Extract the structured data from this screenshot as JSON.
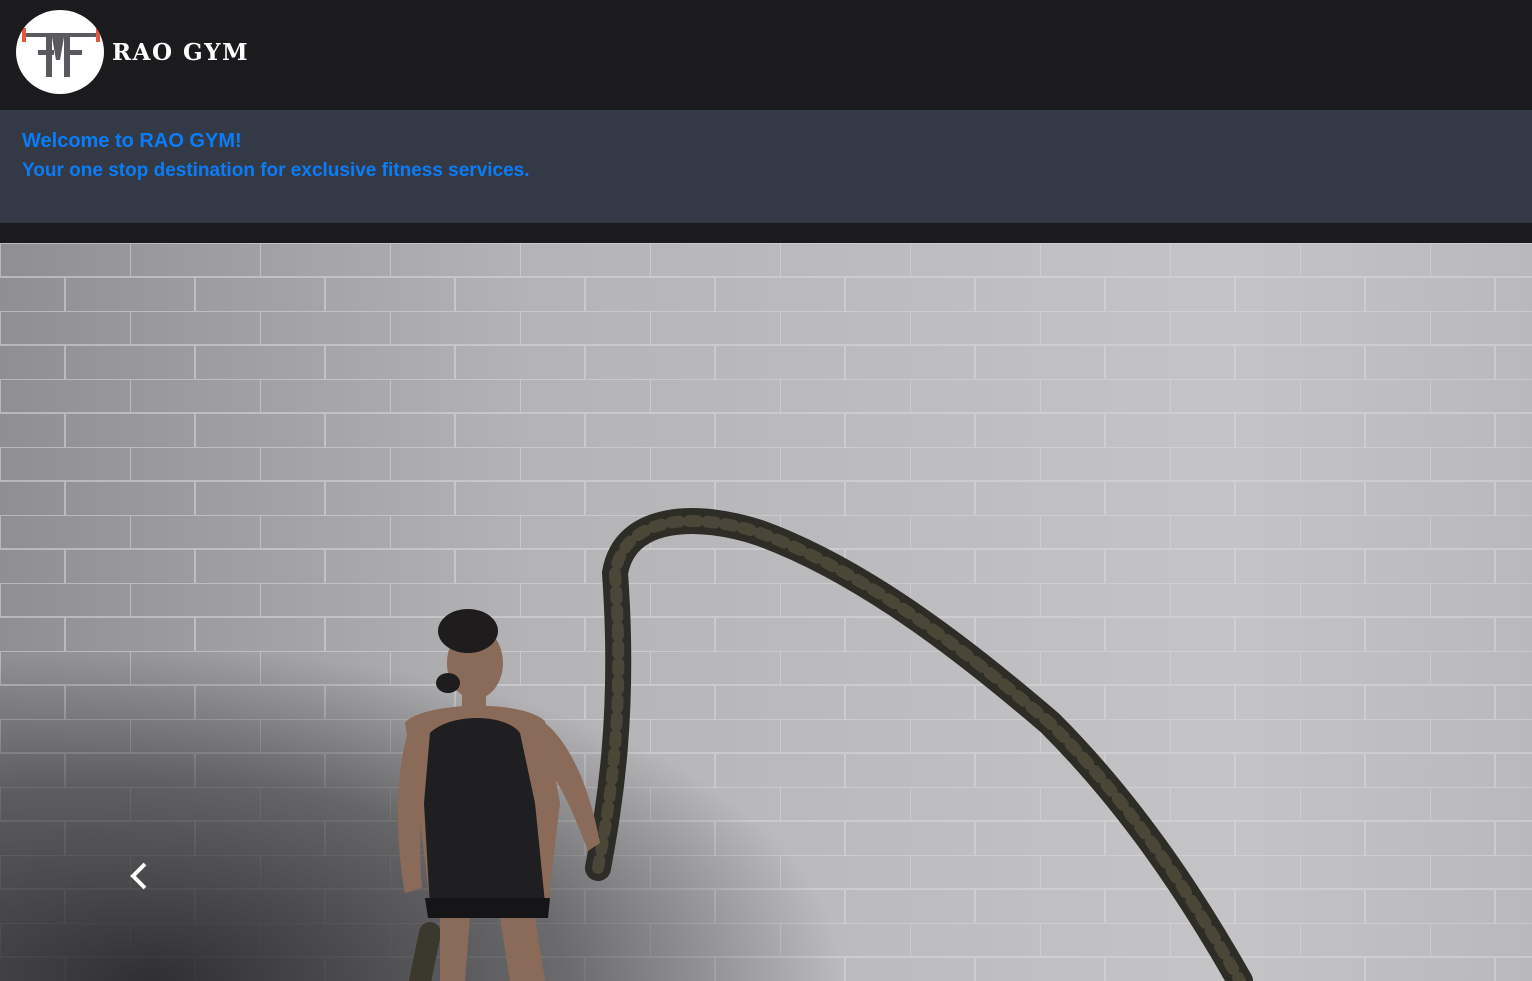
{
  "navbar": {
    "brand_name": "RAO GYM",
    "logo_icon": "rao-gym-logo"
  },
  "welcome": {
    "title": "Welcome to RAO GYM!",
    "subtitle": "Your one stop destination for exclusive fitness services."
  },
  "carousel": {
    "slide_image": "battle-rope-workout-photo",
    "prev_icon": "chevron-left-icon"
  },
  "colors": {
    "navbar_bg": "#1b1a1c",
    "welcome_bg": "#343a45",
    "accent_text": "#0a7cf8",
    "logo_accent": "#e2583e"
  }
}
